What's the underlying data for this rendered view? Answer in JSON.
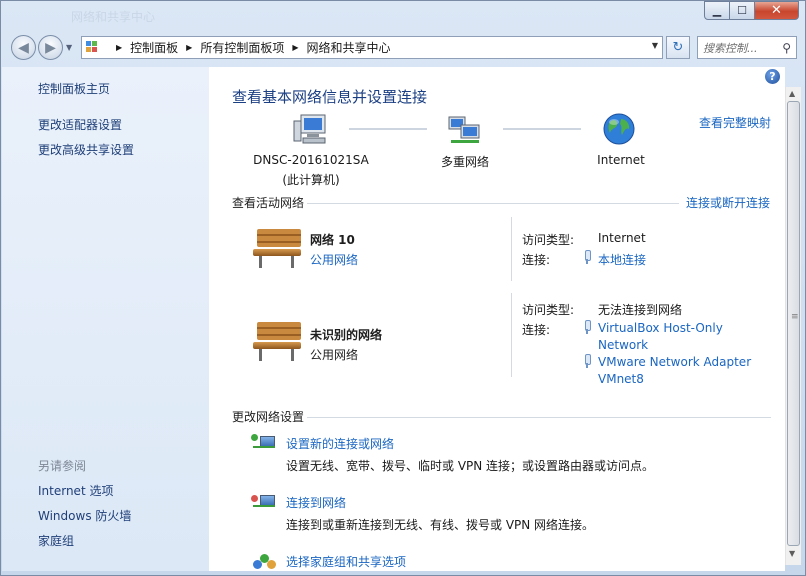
{
  "window": {
    "ghost_title": "网络和共享中心",
    "buttons": {
      "minimize": "▁",
      "maximize": "☐",
      "close": "✕"
    }
  },
  "nav": {
    "back_glyph": "◀",
    "forward_glyph": "▶",
    "breadcrumbs": [
      "控制面板",
      "所有控制面板项",
      "网络和共享中心"
    ],
    "search_placeholder": "搜索控制...",
    "refresh_glyph": "↻",
    "search_glyph": "⚲"
  },
  "sidebar": {
    "links": [
      "控制面板主页",
      "更改适配器设置",
      "更改高级共享设置"
    ],
    "see_also_heading": "另请参阅",
    "see_also": [
      "Internet 选项",
      "Windows 防火墙",
      "家庭组"
    ]
  },
  "main": {
    "title": "查看基本网络信息并设置连接",
    "full_map_link": "查看完整映射",
    "map": {
      "computer": {
        "name": "DNSC-20161021SA",
        "sub": "(此计算机)"
      },
      "network": "多重网络",
      "internet": "Internet"
    },
    "active_networks": {
      "heading": "查看活动网络",
      "connect_link": "连接或断开连接",
      "networks": [
        {
          "name": "网络  10",
          "type": "公用网络",
          "access_label": "访问类型:",
          "access_value": "Internet",
          "conn_label": "连接:",
          "connections": [
            "本地连接"
          ]
        },
        {
          "name": "未识别的网络",
          "type": "公用网络",
          "access_label": "访问类型:",
          "access_value": "无法连接到网络",
          "conn_label": "连接:",
          "connections": [
            "VirtualBox Host-Only",
            "Network",
            "VMware Network Adapter",
            "VMnet8"
          ]
        }
      ]
    },
    "change_settings": {
      "heading": "更改网络设置",
      "tasks": [
        {
          "title": "设置新的连接或网络",
          "desc": "设置无线、宽带、拨号、临时或 VPN 连接；或设置路由器或访问点。"
        },
        {
          "title": "连接到网络",
          "desc": "连接到或重新连接到无线、有线、拨号或 VPN 网络连接。"
        },
        {
          "title": "选择家庭组和共享选项",
          "desc": ""
        }
      ]
    }
  },
  "help_glyph": "?",
  "colors": {
    "link": "#1a66c2",
    "title": "#1b3f83",
    "sidebar_link": "#1f3f78"
  }
}
